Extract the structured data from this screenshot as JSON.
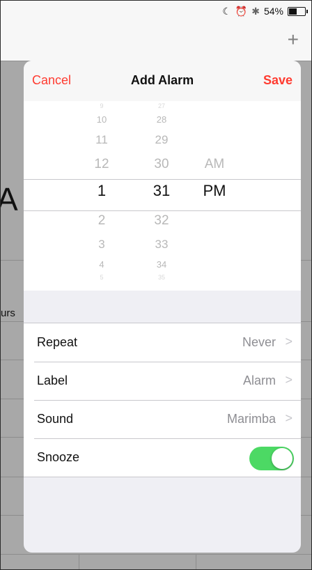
{
  "status_bar": {
    "battery": "54%",
    "moon_icon": "moon-icon",
    "alarm_icon": "alarm-clock-icon",
    "bluetooth_icon": "bluetooth-icon",
    "battery_level": 0.54
  },
  "background": {
    "plus": "+",
    "letter": "A",
    "side_text": "urs"
  },
  "modal": {
    "cancel_label": "Cancel",
    "title": "Add Alarm",
    "save_label": "Save"
  },
  "picker": {
    "hours": [
      "9",
      "10",
      "11",
      "12",
      "1",
      "2",
      "3",
      "4",
      "5"
    ],
    "minutes": [
      "27",
      "28",
      "29",
      "30",
      "31",
      "32",
      "33",
      "34",
      "35"
    ],
    "period_am": "AM",
    "period_pm": "PM"
  },
  "settings": {
    "repeat": {
      "label": "Repeat",
      "value": "Never",
      "chevron": ">"
    },
    "label": {
      "label": "Label",
      "value": "Alarm",
      "chevron": ">"
    },
    "sound": {
      "label": "Sound",
      "value": "Marimba",
      "chevron": ">"
    },
    "snooze": {
      "label": "Snooze",
      "enabled": true
    }
  },
  "colors": {
    "accent": "#ff3b30",
    "toggle_on": "#4cd964"
  }
}
